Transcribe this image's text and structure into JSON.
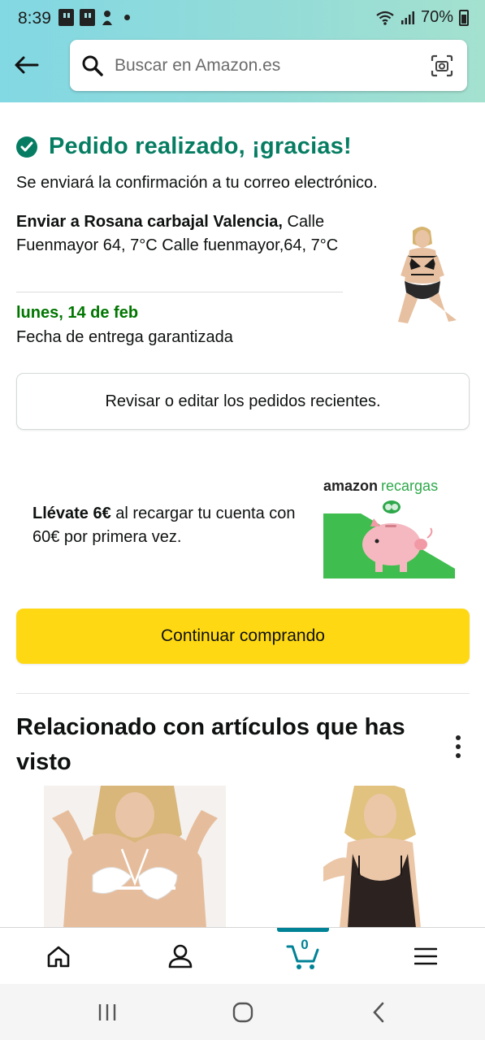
{
  "status_bar": {
    "time": "8:39",
    "battery": "70%"
  },
  "header": {
    "search_placeholder": "Buscar en Amazon.es"
  },
  "confirmation": {
    "title": "Pedido realizado, ¡gracias!",
    "email_note": "Se enviará la confirmación a tu correo electrónico.",
    "ship_to_label": "Enviar a Rosana carbajal Valencia,",
    "ship_to_address": " Calle Fuenmayor 64, 7°C Calle fuenmayor,64, 7°C",
    "delivery_date": "lunes, 14 de feb",
    "delivery_note": "Fecha de entrega garantizada",
    "review_button": "Revisar o editar los pedidos recientes."
  },
  "promo": {
    "bold": "Llévate 6€",
    "text": " al recargar tu cuenta con 60€ por primera vez.",
    "logo_brand": "amazon",
    "logo_product": "recargas"
  },
  "continue_button": "Continuar comprando",
  "related": {
    "title": "Relacionado con artículos que has visto"
  },
  "bottom_nav": {
    "cart_count": "0"
  },
  "colors": {
    "accent_green": "#067d62",
    "delivery_green": "#007600",
    "button_yellow": "#ffd814",
    "cart_teal": "#008296"
  }
}
